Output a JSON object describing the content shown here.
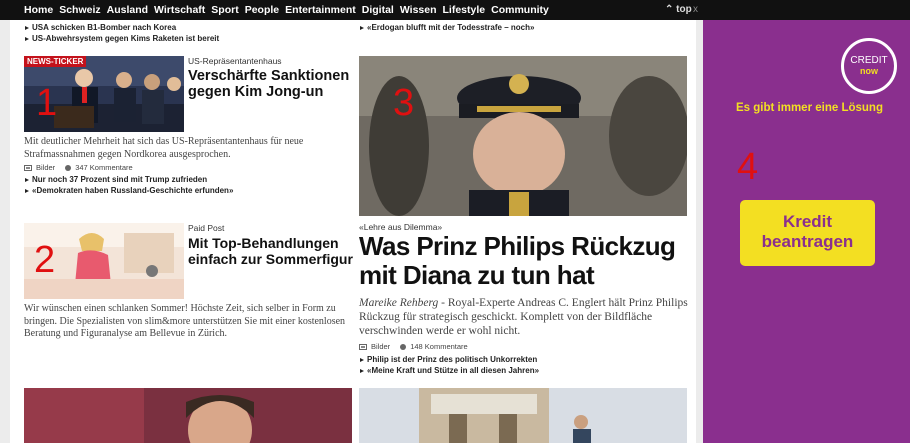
{
  "nav": {
    "items": [
      "Home",
      "Schweiz",
      "Ausland",
      "Wirtschaft",
      "Sport",
      "People",
      "Entertainment",
      "Digital",
      "Wissen",
      "Lifestyle",
      "Community"
    ],
    "top_label": "top",
    "close_label": "x"
  },
  "top_left_links": [
    "USA schicken B1-Bomber nach Korea",
    "US-Abwehrsystem gegen Kims Raketen ist bereit"
  ],
  "top_right_links": [
    "«Erdogan blufft mit der Todesstrafe – noch»"
  ],
  "article1": {
    "badge": "NEWS-TICKER",
    "number": "1",
    "kicker": "US-Repräsentantenhaus",
    "headline": "Verschärfte Sanktionen gegen Kim Jong-un",
    "teaser": "Mit deutlicher Mehrheit hat sich das US-Repräsentantenhaus für neue Strafmassnahmen gegen Nordkorea ausgesprochen.",
    "images_label": "Bilder",
    "comments_label": "347 Kommentare",
    "related": [
      "Nur noch 37 Prozent sind mit Trump zufrieden",
      "«Demokraten haben Russland-Geschichte erfunden»"
    ]
  },
  "article2": {
    "number": "2",
    "kicker": "Paid Post",
    "headline": "Mit Top-Behandlungen einfach zur Sommerfigur",
    "teaser": "Wir wünschen einen schlanken Sommer! Höchste Zeit, sich selber in Form zu bringen. Die Spezialisten von slim&more unterstützen Sie mit einer kostenlosen Beratung und Figuranalyse am Bellevue in Zürich."
  },
  "article3": {
    "number": "3",
    "kicker": "«Lehre aus Dilemma»",
    "headline": "Was Prinz Philips Rückzug mit Diana zu tun hat",
    "author": "Mareike Rehberg",
    "teaser": " - Royal-Experte Andreas C. Englert hält Prinz Philips Rückzug für strategisch geschickt. Komplett von der Bildfläche verschwinden werde er wohl nicht.",
    "images_label": "Bilder",
    "comments_label": "148 Kommentare",
    "related": [
      "Philip ist der Prinz des politisch Unkorrekten",
      "«Meine Kraft und Stütze in all diesen Jahren»"
    ]
  },
  "ad": {
    "number": "4",
    "logo_line1": "CREDIT",
    "logo_line2": "now",
    "tagline": "Es gibt immer eine Lösung",
    "button": "Kredit beantragen",
    "colors": {
      "background": "#8a2f8e",
      "accent": "#f3df22"
    }
  }
}
